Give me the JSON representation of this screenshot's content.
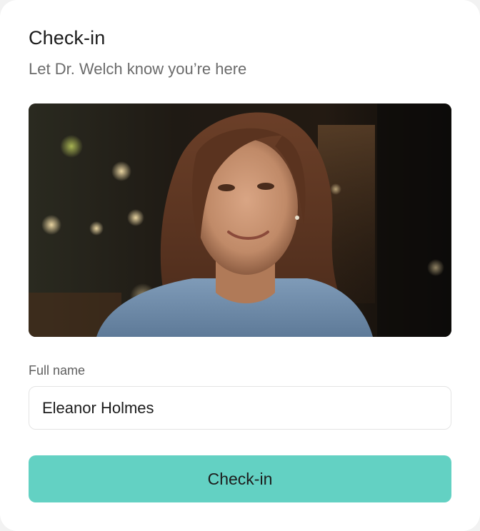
{
  "header": {
    "title": "Check-in",
    "subtitle": "Let Dr. Welch know you’re here"
  },
  "form": {
    "name_label": "Full name",
    "name_value": "Eleanor Holmes",
    "submit_label": "Check-in"
  },
  "colors": {
    "accent": "#63d1c3",
    "card_background": "#ffffff",
    "title_text": "#1c1c1c",
    "muted_text": "#6b6b6b"
  }
}
